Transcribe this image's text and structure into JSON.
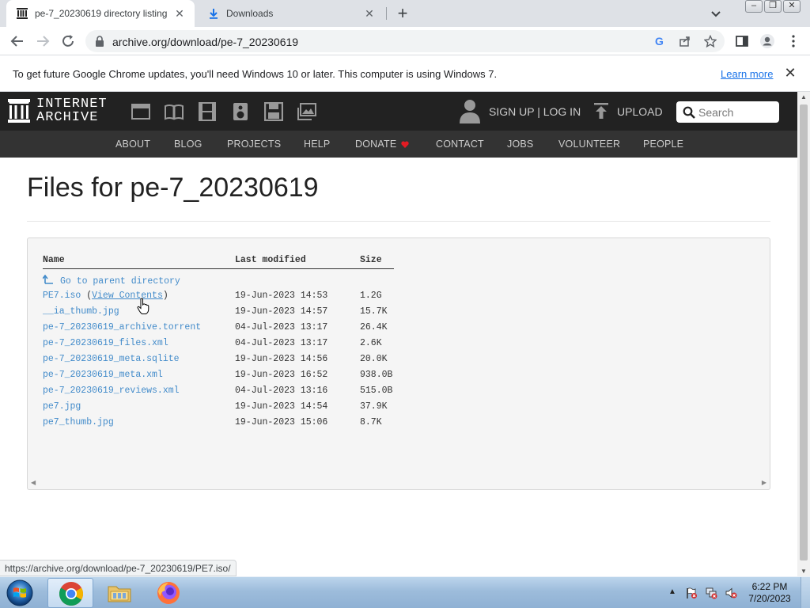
{
  "browser": {
    "tabs": [
      {
        "title": "pe-7_20230619 directory listing",
        "icon": "internet-archive-icon",
        "active": true
      },
      {
        "title": "Downloads",
        "icon": "download-icon",
        "active": false
      }
    ],
    "url": "archive.org/download/pe-7_20230619",
    "status_url": "https://archive.org/download/pe-7_20230619/PE7.iso/"
  },
  "infobar": {
    "message": "To get future Google Chrome updates, you'll need Windows 10 or later. This computer is using Windows 7.",
    "link": "Learn more"
  },
  "ia_header": {
    "logo_line1": "INTERNET",
    "logo_line2": "ARCHIVE",
    "media_icons": [
      "web-icon",
      "texts-icon",
      "video-icon",
      "audio-icon",
      "software-icon",
      "images-icon"
    ],
    "signup": "SIGN UP | LOG IN",
    "upload": "UPLOAD",
    "search_placeholder": "Search",
    "nav": [
      "ABOUT",
      "BLOG",
      "PROJECTS",
      "HELP",
      "DONATE",
      "CONTACT",
      "JOBS",
      "VOLUNTEER",
      "PEOPLE"
    ]
  },
  "page": {
    "title": "Files for pe-7_20230619",
    "columns": {
      "name": "Name",
      "modified": "Last modified",
      "size": "Size"
    },
    "parent": "Go to parent directory",
    "view_contents": "View Contents",
    "files": [
      {
        "name": "PE7.iso",
        "date": "19-Jun-2023 14:53",
        "size": "1.2G"
      },
      {
        "name": "__ia_thumb.jpg",
        "date": "19-Jun-2023 14:57",
        "size": "15.7K"
      },
      {
        "name": "pe-7_20230619_archive.torrent",
        "date": "04-Jul-2023 13:17",
        "size": "26.4K"
      },
      {
        "name": "pe-7_20230619_files.xml",
        "date": "04-Jul-2023 13:17",
        "size": "2.6K"
      },
      {
        "name": "pe-7_20230619_meta.sqlite",
        "date": "19-Jun-2023 14:56",
        "size": "20.0K"
      },
      {
        "name": "pe-7_20230619_meta.xml",
        "date": "19-Jun-2023 16:52",
        "size": "938.0B"
      },
      {
        "name": "pe-7_20230619_reviews.xml",
        "date": "04-Jul-2023 13:16",
        "size": "515.0B"
      },
      {
        "name": "pe7.jpg",
        "date": "19-Jun-2023 14:54",
        "size": "37.9K"
      },
      {
        "name": "pe7_thumb.jpg",
        "date": "19-Jun-2023 15:06",
        "size": "8.7K"
      }
    ]
  },
  "taskbar": {
    "time": "6:22 PM",
    "date": "7/20/2023"
  },
  "colors": {
    "link": "#428bca",
    "ia_dark": "#222222",
    "ia_nav": "#333333",
    "donate_heart": "#e31b23"
  }
}
